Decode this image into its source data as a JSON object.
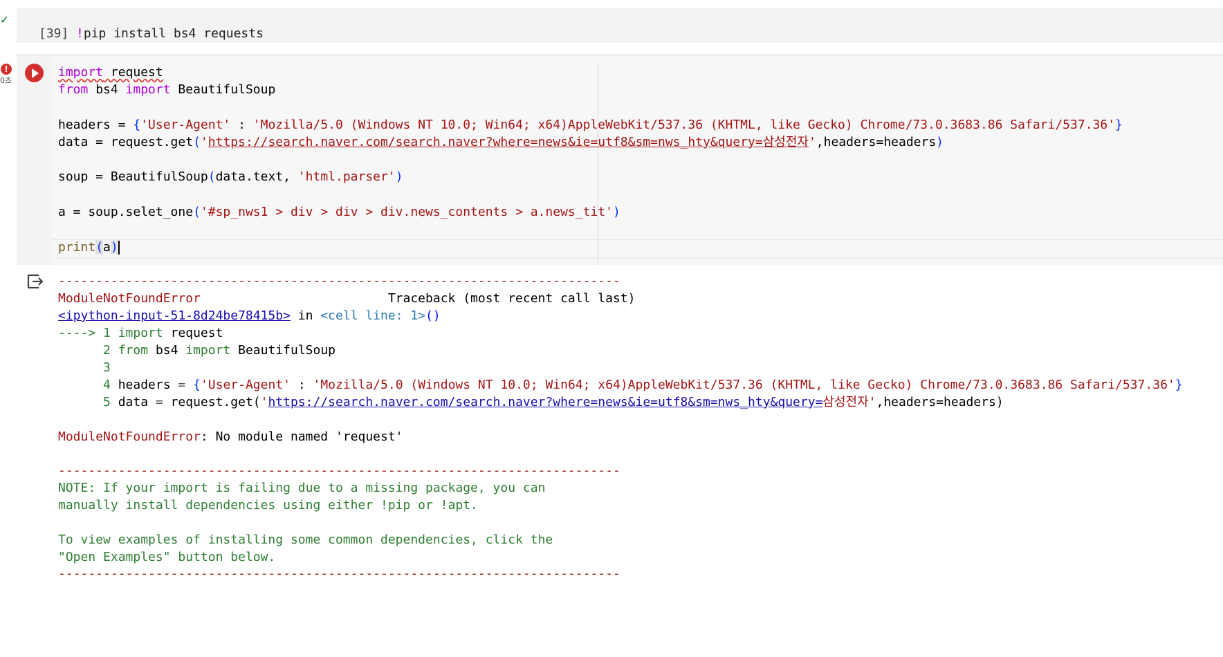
{
  "cell1": {
    "status_icon": "check-icon",
    "exec_count": "[39]",
    "bang": "!",
    "code": "pip install bs4 requests"
  },
  "cell2": {
    "status_badge": "!",
    "run_time": "0초",
    "run_icon": "play-icon",
    "lines": {
      "l1_kw": "import",
      "l1_mod": " request",
      "l2_from": "from",
      "l2_mod": " bs4 ",
      "l2_import": "import",
      "l2_name": " BeautifulSoup",
      "l4_pre": "headers = ",
      "l4_open": "{",
      "l4_key": "'User-Agent'",
      "l4_colon": " : ",
      "l4_val": "'Mozilla/5.0 (Windows NT 10.0; Win64; x64)AppleWebKit/537.36 (KHTML, like Gecko) Chrome/73.0.3683.86 Safari/537.36'",
      "l4_close": "}",
      "l5_pre": "data = request.get",
      "l5_open": "(",
      "l5_q1": "'",
      "l5_url": "https://search.naver.com/search.naver?where=news&ie=utf8&sm=nws_hty&query=삼성전자",
      "l5_q2": "'",
      "l5_rest": ",headers=headers",
      "l5_close": ")",
      "l7_pre": "soup = BeautifulSoup",
      "l7_open": "(",
      "l7_mid": "data.text, ",
      "l7_str": "'html.parser'",
      "l7_close": ")",
      "l9_pre": "a = soup.selet_one",
      "l9_open": "(",
      "l9_str": "'#sp_nws1 > div > div > div.news_contents > a.news_tit'",
      "l9_close": ")",
      "l11_fn": "print",
      "l11_open": "(",
      "l11_arg": "a",
      "l11_close": ")"
    }
  },
  "output": {
    "icon": "output-redirect-icon",
    "dashes": "---------------------------------------------------------------------------",
    "err_name": "ModuleNotFoundError",
    "traceback": "                         Traceback (most recent call last)",
    "tb_link": "<ipython-input-51-8d24be78415b>",
    "tb_in": " in ",
    "tb_cell": "<cell line: 1>",
    "tb_paren": "()",
    "arrow": "----> 1 ",
    "f1_kw": "import",
    "f1_rest": " request",
    "f2_num": "      2 ",
    "f2_from": "from",
    "f2_mod": " bs4 ",
    "f2_import": "import",
    "f2_name": " BeautifulSoup",
    "f3_num": "      3",
    "f4_num": "      4 ",
    "f4_pre": "headers ",
    "f4_eq": "=",
    "f4_sp": " ",
    "f4_open": "{",
    "f4_key": "'User-Agent'",
    "f4_colon": " : ",
    "f4_val": "'Mozilla/5.0 (Windows NT 10.0; Win64; x64)AppleWebKit/537.36 (KHTML, like Gecko) Chrome/73.0.3683.86 Safari/537.36'",
    "f4_close": "}",
    "f5_num": "      5 ",
    "f5_pre": "data ",
    "f5_eq": "=",
    "f5_mid": " request.get(",
    "f5_q1": "'",
    "f5_url": "https://search.naver.com/search.naver?where=news&ie=utf8&sm=nws_hty&query=",
    "f5_kr": "삼성전자'",
    "f5_rest": ",headers=headers)",
    "err_line_name": "ModuleNotFoundError",
    "err_line_msg": ": No module named 'request'",
    "note1": "NOTE: If your import is failing due to a missing package, you can",
    "note2": "manually install dependencies using either !pip or !apt.",
    "note3": "To view examples of installing some common dependencies, click the",
    "note4": "\"Open Examples\" button below."
  }
}
